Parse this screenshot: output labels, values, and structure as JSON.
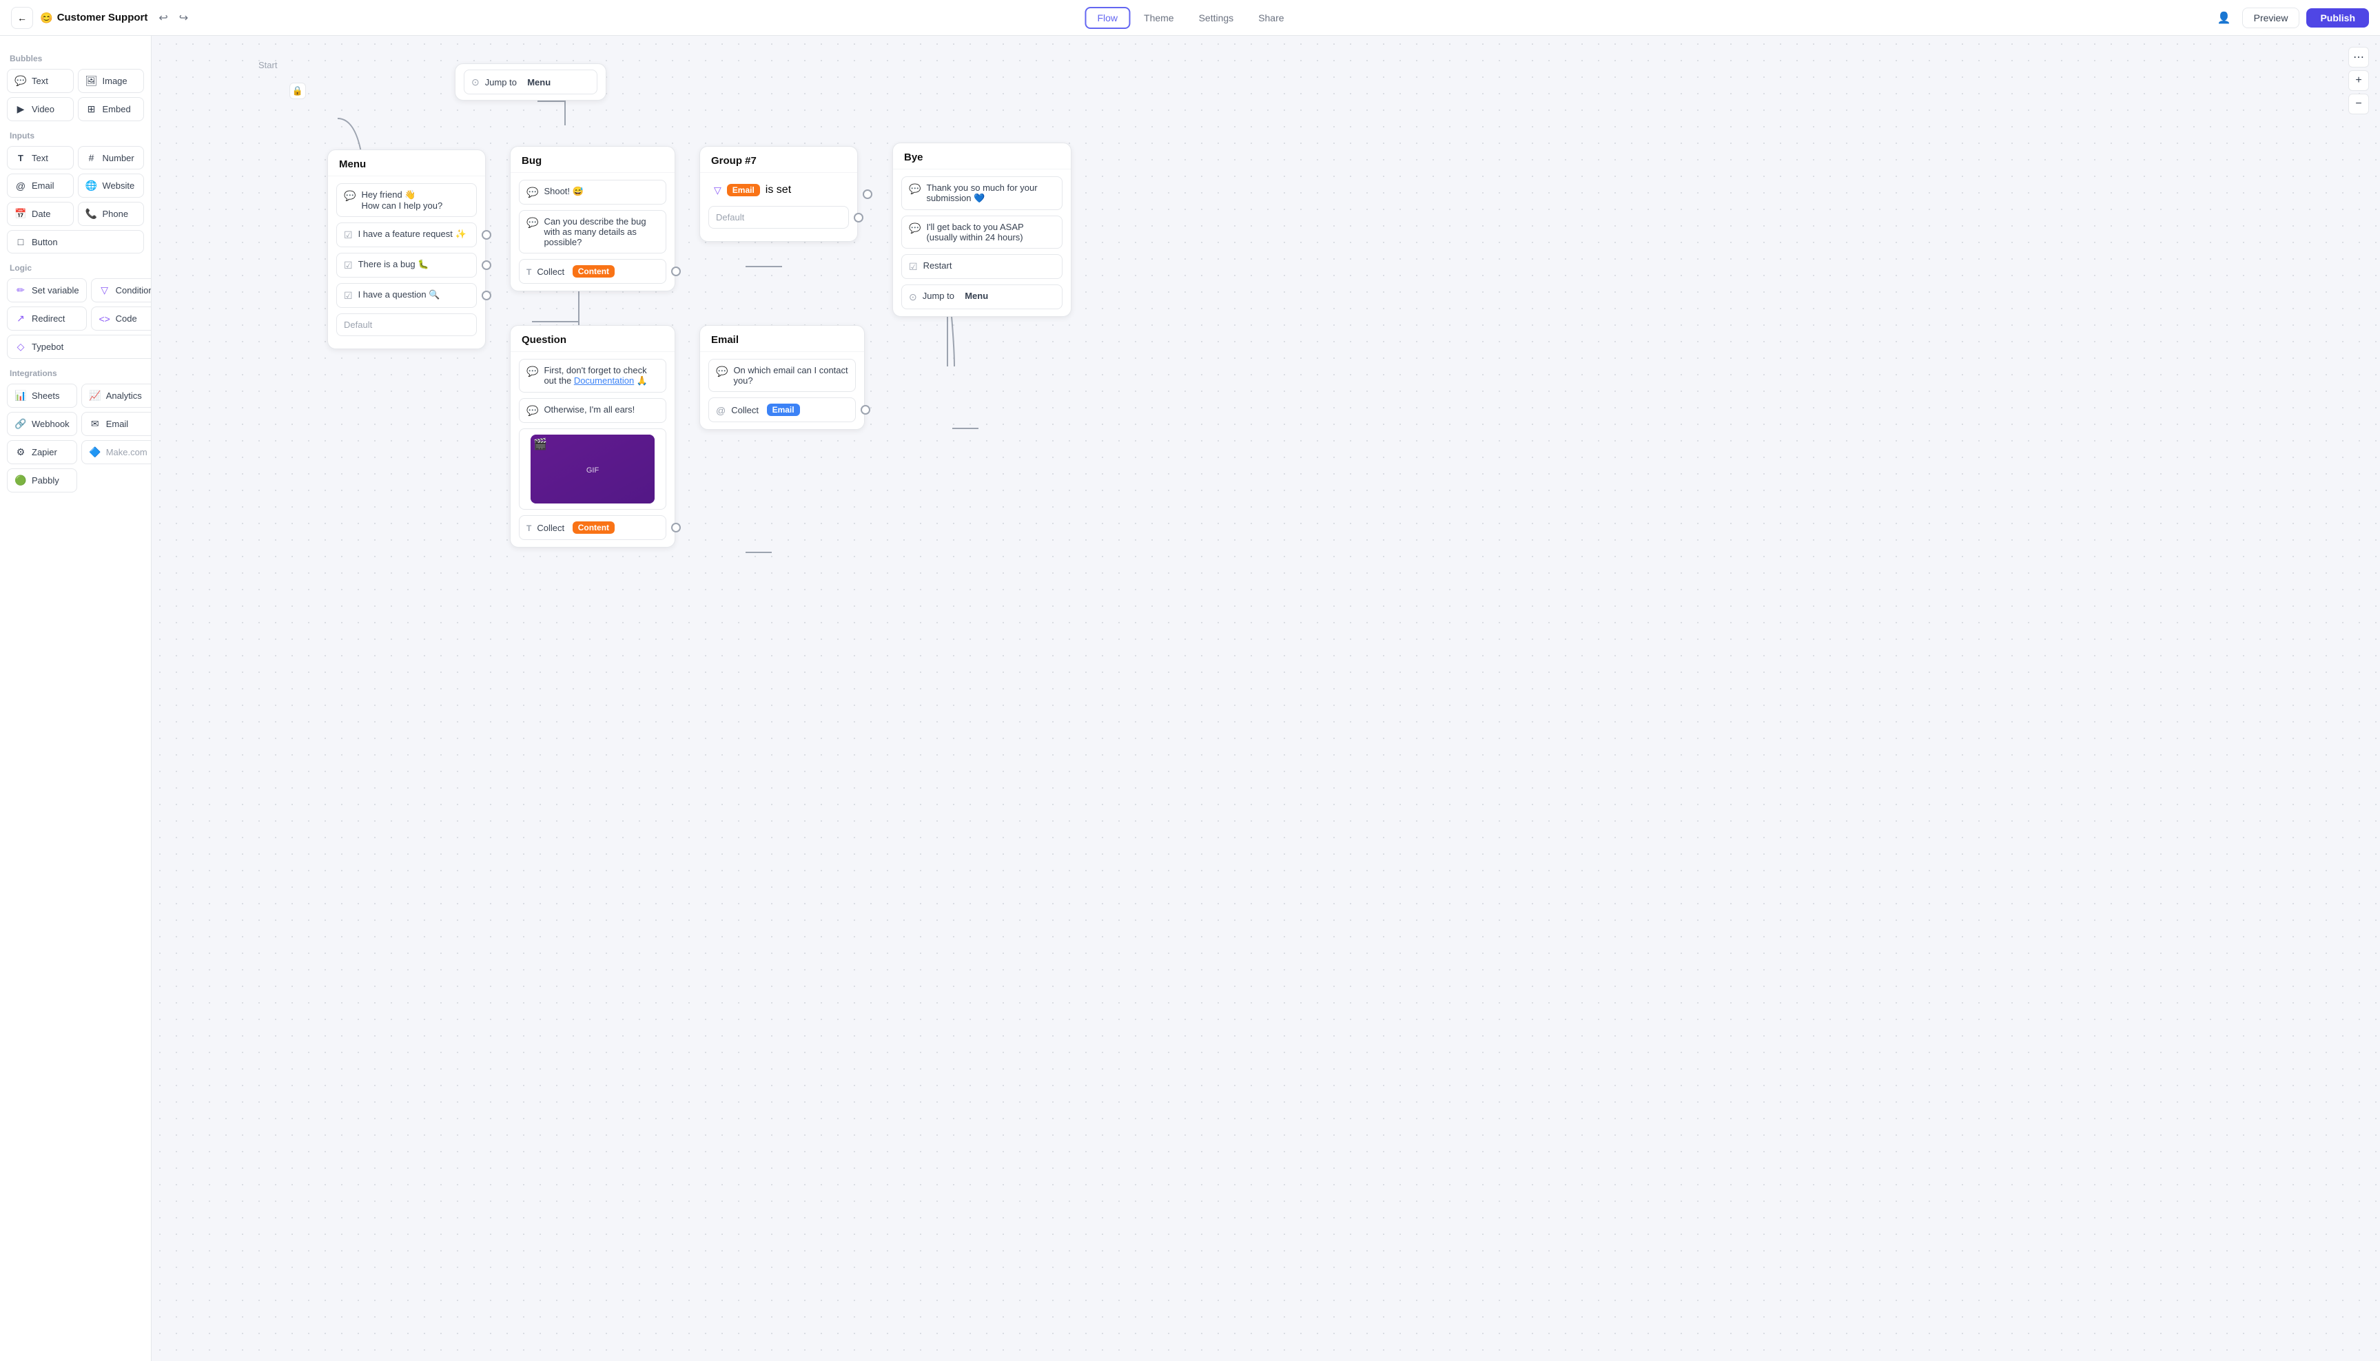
{
  "topnav": {
    "back_icon": "←",
    "bot_emoji": "😊",
    "bot_name": "Customer Support",
    "undo_icon": "↩",
    "redo_icon": "↪",
    "tabs": [
      {
        "label": "Flow",
        "active": true
      },
      {
        "label": "Theme",
        "active": false
      },
      {
        "label": "Settings",
        "active": false
      },
      {
        "label": "Share",
        "active": false
      }
    ],
    "share_icon": "👤",
    "preview_label": "Preview",
    "publish_label": "Publish"
  },
  "sidebar": {
    "bubbles_title": "Bubbles",
    "bubbles_items": [
      {
        "icon": "💬",
        "label": "Text"
      },
      {
        "icon": "🖼",
        "label": "Image"
      },
      {
        "icon": "▶",
        "label": "Video"
      },
      {
        "icon": "⊞",
        "label": "Embed"
      }
    ],
    "inputs_title": "Inputs",
    "inputs_items": [
      {
        "icon": "T",
        "label": "Text"
      },
      {
        "icon": "#",
        "label": "Number"
      },
      {
        "icon": "@",
        "label": "Email"
      },
      {
        "icon": "🌐",
        "label": "Website"
      },
      {
        "icon": "📅",
        "label": "Date"
      },
      {
        "icon": "📞",
        "label": "Phone"
      },
      {
        "icon": "□",
        "label": "Button"
      }
    ],
    "logic_title": "Logic",
    "logic_items": [
      {
        "icon": "✏",
        "label": "Set variable"
      },
      {
        "icon": "▽",
        "label": "Condition"
      },
      {
        "icon": "↗",
        "label": "Redirect"
      },
      {
        "icon": "<>",
        "label": "Code"
      },
      {
        "icon": "◇",
        "label": "Typebot"
      }
    ],
    "integrations_title": "Integrations",
    "integrations_items": [
      {
        "icon": "📊",
        "label": "Sheets"
      },
      {
        "icon": "📈",
        "label": "Analytics"
      },
      {
        "icon": "🔗",
        "label": "Webhook"
      },
      {
        "icon": "✉",
        "label": "Email"
      },
      {
        "icon": "⚙",
        "label": "Zapier"
      },
      {
        "icon": "🔷",
        "label": "Make.com"
      },
      {
        "icon": "🟢",
        "label": "Pabbly"
      }
    ]
  },
  "nodes": {
    "start_label": "Start",
    "menu": {
      "title": "Menu",
      "greeting": "Hey friend 👋\nHow can I help you?",
      "options": [
        "I have a feature request ✨",
        "There is a bug 🐛",
        "I have a question 🔍"
      ],
      "default_label": "Default"
    },
    "bug": {
      "title": "Bug",
      "rows": [
        {
          "type": "text",
          "content": "Shoot! 😅"
        },
        {
          "type": "text",
          "content": "Can you describe the bug with as many details as possible?"
        },
        {
          "type": "collect",
          "label": "Collect",
          "tag": "Content",
          "tag_color": "orange"
        }
      ]
    },
    "question": {
      "title": "Question",
      "rows": [
        {
          "type": "text",
          "content": "First, don't forget to check out the Documentation 🙏"
        },
        {
          "type": "text",
          "content": "Otherwise, I'm all ears!"
        },
        {
          "type": "gif",
          "content": ""
        },
        {
          "type": "collect",
          "label": "Collect",
          "tag": "Content",
          "tag_color": "orange"
        }
      ]
    },
    "group7": {
      "title": "Group #7",
      "condition": "Email is set",
      "default_label": "Default"
    },
    "email": {
      "title": "Email",
      "rows": [
        {
          "type": "text",
          "content": "On which email can I contact you?"
        },
        {
          "type": "collect",
          "label": "Collect",
          "tag": "Email",
          "tag_color": "blue"
        }
      ]
    },
    "bye": {
      "title": "Bye",
      "rows": [
        {
          "type": "text",
          "content": "Thank you so much for your submission 💙"
        },
        {
          "type": "text",
          "content": "I'll get back to you ASAP (usually within 24 hours)"
        },
        {
          "type": "restart",
          "content": "Restart"
        },
        {
          "type": "jumpto",
          "content": "Jump to",
          "target": "Menu"
        }
      ]
    },
    "jump_to_menu": {
      "label": "Jump to",
      "target": "Menu"
    }
  },
  "zoom": {
    "more_icon": "⋯",
    "plus_icon": "+",
    "minus_icon": "−"
  }
}
